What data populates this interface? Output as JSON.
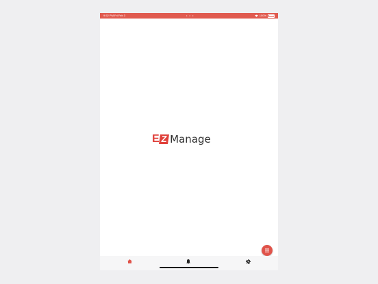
{
  "status_bar": {
    "time_date": "9:52 PM   Fri Feb 3",
    "dots": "• • •",
    "battery_percent": "100%",
    "battery_level": 1.0
  },
  "logo": {
    "letter_e": "E",
    "letter_z": "Z",
    "text": "Manage"
  },
  "fab": {
    "icon": "menu-icon"
  },
  "tabbar": {
    "tabs": [
      {
        "icon": "home-icon",
        "active": true
      },
      {
        "icon": "bell-icon",
        "active": false
      },
      {
        "icon": "gear-icon",
        "active": false
      }
    ]
  },
  "colors": {
    "accent": "#e05a4f",
    "logo_red": "#e0413b"
  }
}
